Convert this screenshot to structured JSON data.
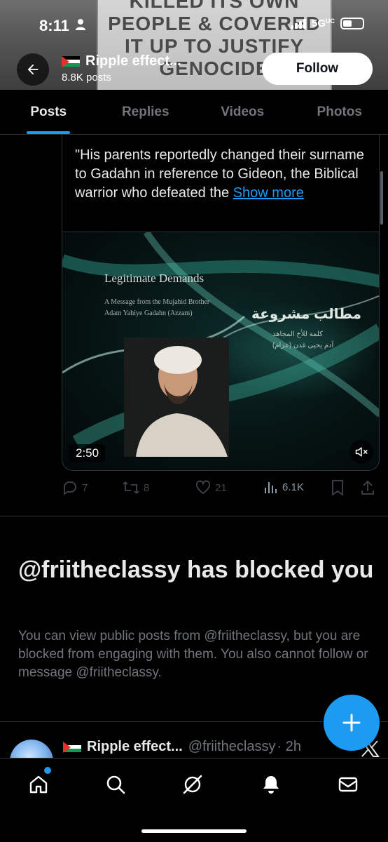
{
  "status_bar": {
    "time": "8:11",
    "network": "5G",
    "network_suffix": "UC"
  },
  "banner": {
    "sign_lines": [
      "KILLED ITS OWN",
      "PEOPLE & COVERED",
      "IT UP TO JUSTIFY",
      "GENOCIDE"
    ]
  },
  "header": {
    "name": "Ripple effect...",
    "posts_count": "8.8K posts",
    "follow_label": "Follow"
  },
  "tabs": [
    {
      "label": "Posts",
      "active": true
    },
    {
      "label": "Replies",
      "active": false
    },
    {
      "label": "Videos",
      "active": false
    },
    {
      "label": "Photos",
      "active": false
    }
  ],
  "quoted_post": {
    "text": "\"His parents reportedly changed their surname to Gadahn in reference to Gideon, the Biblical warrior who defeated the",
    "show_more": "Show more",
    "video": {
      "duration": "2:50",
      "title": "Legitimate Demands",
      "subtitle_1": "A Message from the Mujahid Brother",
      "subtitle_2": "Adam Yahiye Gadahn (Azzam)",
      "arabic_title": "مطالب مشروعة",
      "arabic_sub_1": "كلمة للأخ المجاهد",
      "arabic_sub_2": "آدم يحيى غدن (عزام)"
    }
  },
  "actions": {
    "replies": "7",
    "reposts": "8",
    "likes": "21",
    "views": "6.1K"
  },
  "blocked": {
    "title": "@friitheclassy has blocked you",
    "body": "You can view public posts from @friitheclassy, but you are blocked from engaging with them. You also cannot follow or message @friitheclassy."
  },
  "next_post": {
    "name": "Ripple effect...",
    "handle": "@friitheclassy",
    "time": "· 2h"
  },
  "colors": {
    "accent": "#1d9bf0",
    "background": "#000000",
    "muted": "#71767b"
  },
  "icons": {
    "nav": [
      "home-icon",
      "search-icon",
      "grok-icon",
      "notifications-icon",
      "messages-icon"
    ],
    "fab": "plus-icon"
  }
}
